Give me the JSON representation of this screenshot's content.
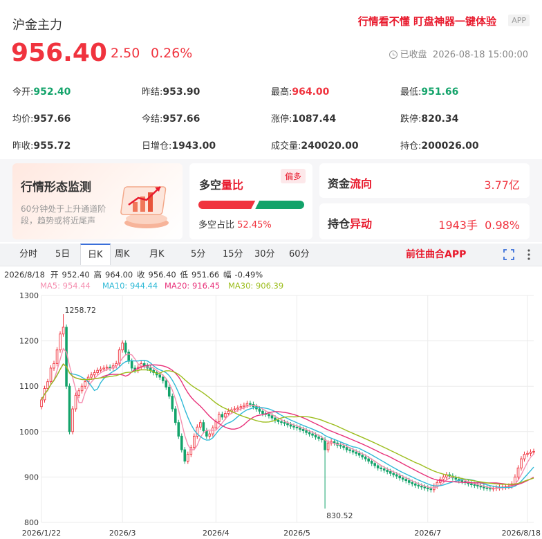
{
  "header": {
    "title": "沪金主力",
    "promo": "行情看不懂 盯盘神器一键体验",
    "app_tag": "APP",
    "price": "956.40",
    "change": "2.50",
    "change_pct": "0.26%",
    "status": "已收盘",
    "datetime": "2026-08-18 15:00:00"
  },
  "stats": [
    [
      {
        "label": "今开:",
        "value": "952.40",
        "color": "down"
      },
      {
        "label": "昨结:",
        "value": "953.90",
        "color": ""
      },
      {
        "label": "最高:",
        "value": "964.00",
        "color": "up"
      },
      {
        "label": "最低:",
        "value": "951.66",
        "color": "down"
      }
    ],
    [
      {
        "label": "均价:",
        "value": "957.66",
        "color": ""
      },
      {
        "label": "今结:",
        "value": "957.66",
        "color": ""
      },
      {
        "label": "涨停:",
        "value": "1087.44",
        "color": ""
      },
      {
        "label": "跌停:",
        "value": "820.34",
        "color": ""
      }
    ],
    [
      {
        "label": "昨收:",
        "value": "955.72",
        "color": ""
      },
      {
        "label": "日增仓:",
        "value": "1943.00",
        "color": ""
      },
      {
        "label": "成交量:",
        "value": "240020.00",
        "color": ""
      },
      {
        "label": "持仓:",
        "value": "200026.00",
        "color": ""
      }
    ]
  ],
  "cards": {
    "trend": {
      "title_a": "行情形态",
      "title_b": "监测",
      "desc": "60分钟处于上升通道阶段，趋势或将近尾声"
    },
    "longshort": {
      "title_a": "多空",
      "title_b": "量比",
      "badge": "偏多",
      "label": "多空占比",
      "value": "52.45%",
      "long_ratio": 0.5245
    },
    "capital": {
      "title_a": "资金",
      "title_b": "流向",
      "value": "3.77亿"
    },
    "position": {
      "title_a": "持仓",
      "title_b": "异动",
      "value": "1943手",
      "pct": "0.98%"
    }
  },
  "tabs": [
    "分时",
    "5日",
    "日K",
    "周K",
    "月K",
    "5分",
    "15分",
    "30分",
    "60分"
  ],
  "active_tab": "日K",
  "go_app": "前往曲合APP",
  "colors": {
    "up": "#f0333e",
    "down": "#13a36a",
    "accent": "#e8192c",
    "ma5": "#f58fb0",
    "ma10": "#2fb9d6",
    "ma20": "#e8327a",
    "ma30": "#9cbd1d"
  },
  "chart_data": {
    "type": "candlestick",
    "info_line": {
      "date": "2026/8/18",
      "open_label": "开",
      "open": "952.40",
      "high_label": "高",
      "high": "964.00",
      "close_label": "收",
      "close": "956.40",
      "low_label": "低",
      "low": "951.66",
      "amp_label": "幅",
      "amp": "-0.49%"
    },
    "ma_legend": [
      {
        "name": "MA5",
        "value": "954.44"
      },
      {
        "name": "MA10",
        "value": "944.44"
      },
      {
        "name": "MA20",
        "value": "916.45"
      },
      {
        "name": "MA30",
        "value": "906.39"
      }
    ],
    "ylim": [
      800,
      1300
    ],
    "y_ticks": [
      "1300",
      "1200",
      "1100",
      "1000",
      "900",
      "800"
    ],
    "y_tick_values": [
      1300,
      1200,
      1100,
      1000,
      900,
      800
    ],
    "x_ticks": [
      {
        "label": "2026/1/22",
        "index": 0
      },
      {
        "label": "2026/3",
        "index": 26
      },
      {
        "label": "2026/4",
        "index": 56
      },
      {
        "label": "2026/5",
        "index": 82
      },
      {
        "label": "2026/7",
        "index": 124
      },
      {
        "label": "2026/8/18",
        "index": 156
      }
    ],
    "annotations": [
      {
        "text": "1258.72",
        "index": 7,
        "value": 1258.72
      },
      {
        "text": "830.52",
        "index": 91,
        "value": 830.52
      }
    ],
    "closes": [
      1070,
      1095,
      1110,
      1140,
      1150,
      1180,
      1215,
      1230,
      1100,
      1000,
      1050,
      1080,
      1090,
      1100,
      1110,
      1120,
      1125,
      1130,
      1135,
      1138,
      1140,
      1142,
      1140,
      1145,
      1150,
      1180,
      1195,
      1175,
      1155,
      1140,
      1135,
      1142,
      1150,
      1145,
      1140,
      1135,
      1130,
      1125,
      1120,
      1112,
      1098,
      1078,
      1050,
      1020,
      990,
      960,
      935,
      950,
      965,
      990,
      1010,
      1020,
      1002,
      990,
      995,
      1008,
      1022,
      1038,
      1032,
      1040,
      1045,
      1048,
      1050,
      1052,
      1055,
      1058,
      1062,
      1060,
      1055,
      1050,
      1045,
      1040,
      1038,
      1035,
      1030,
      1025,
      1022,
      1020,
      1018,
      1015,
      1012,
      1010,
      1008,
      1005,
      1002,
      998,
      995,
      992,
      988,
      985,
      982,
      960,
      975,
      978,
      975,
      970,
      968,
      965,
      960,
      958,
      955,
      952,
      948,
      944,
      940,
      935,
      930,
      925,
      920,
      918,
      915,
      912,
      908,
      905,
      902,
      898,
      895,
      892,
      888,
      885,
      882,
      880,
      878,
      876,
      874,
      872,
      880,
      888,
      895,
      900,
      905,
      902,
      898,
      895,
      892,
      890,
      888,
      885,
      883,
      882,
      880,
      878,
      876,
      875,
      874,
      875,
      876,
      877,
      878,
      879,
      880,
      885,
      900,
      920,
      940,
      950,
      952,
      955,
      956.4
    ]
  }
}
